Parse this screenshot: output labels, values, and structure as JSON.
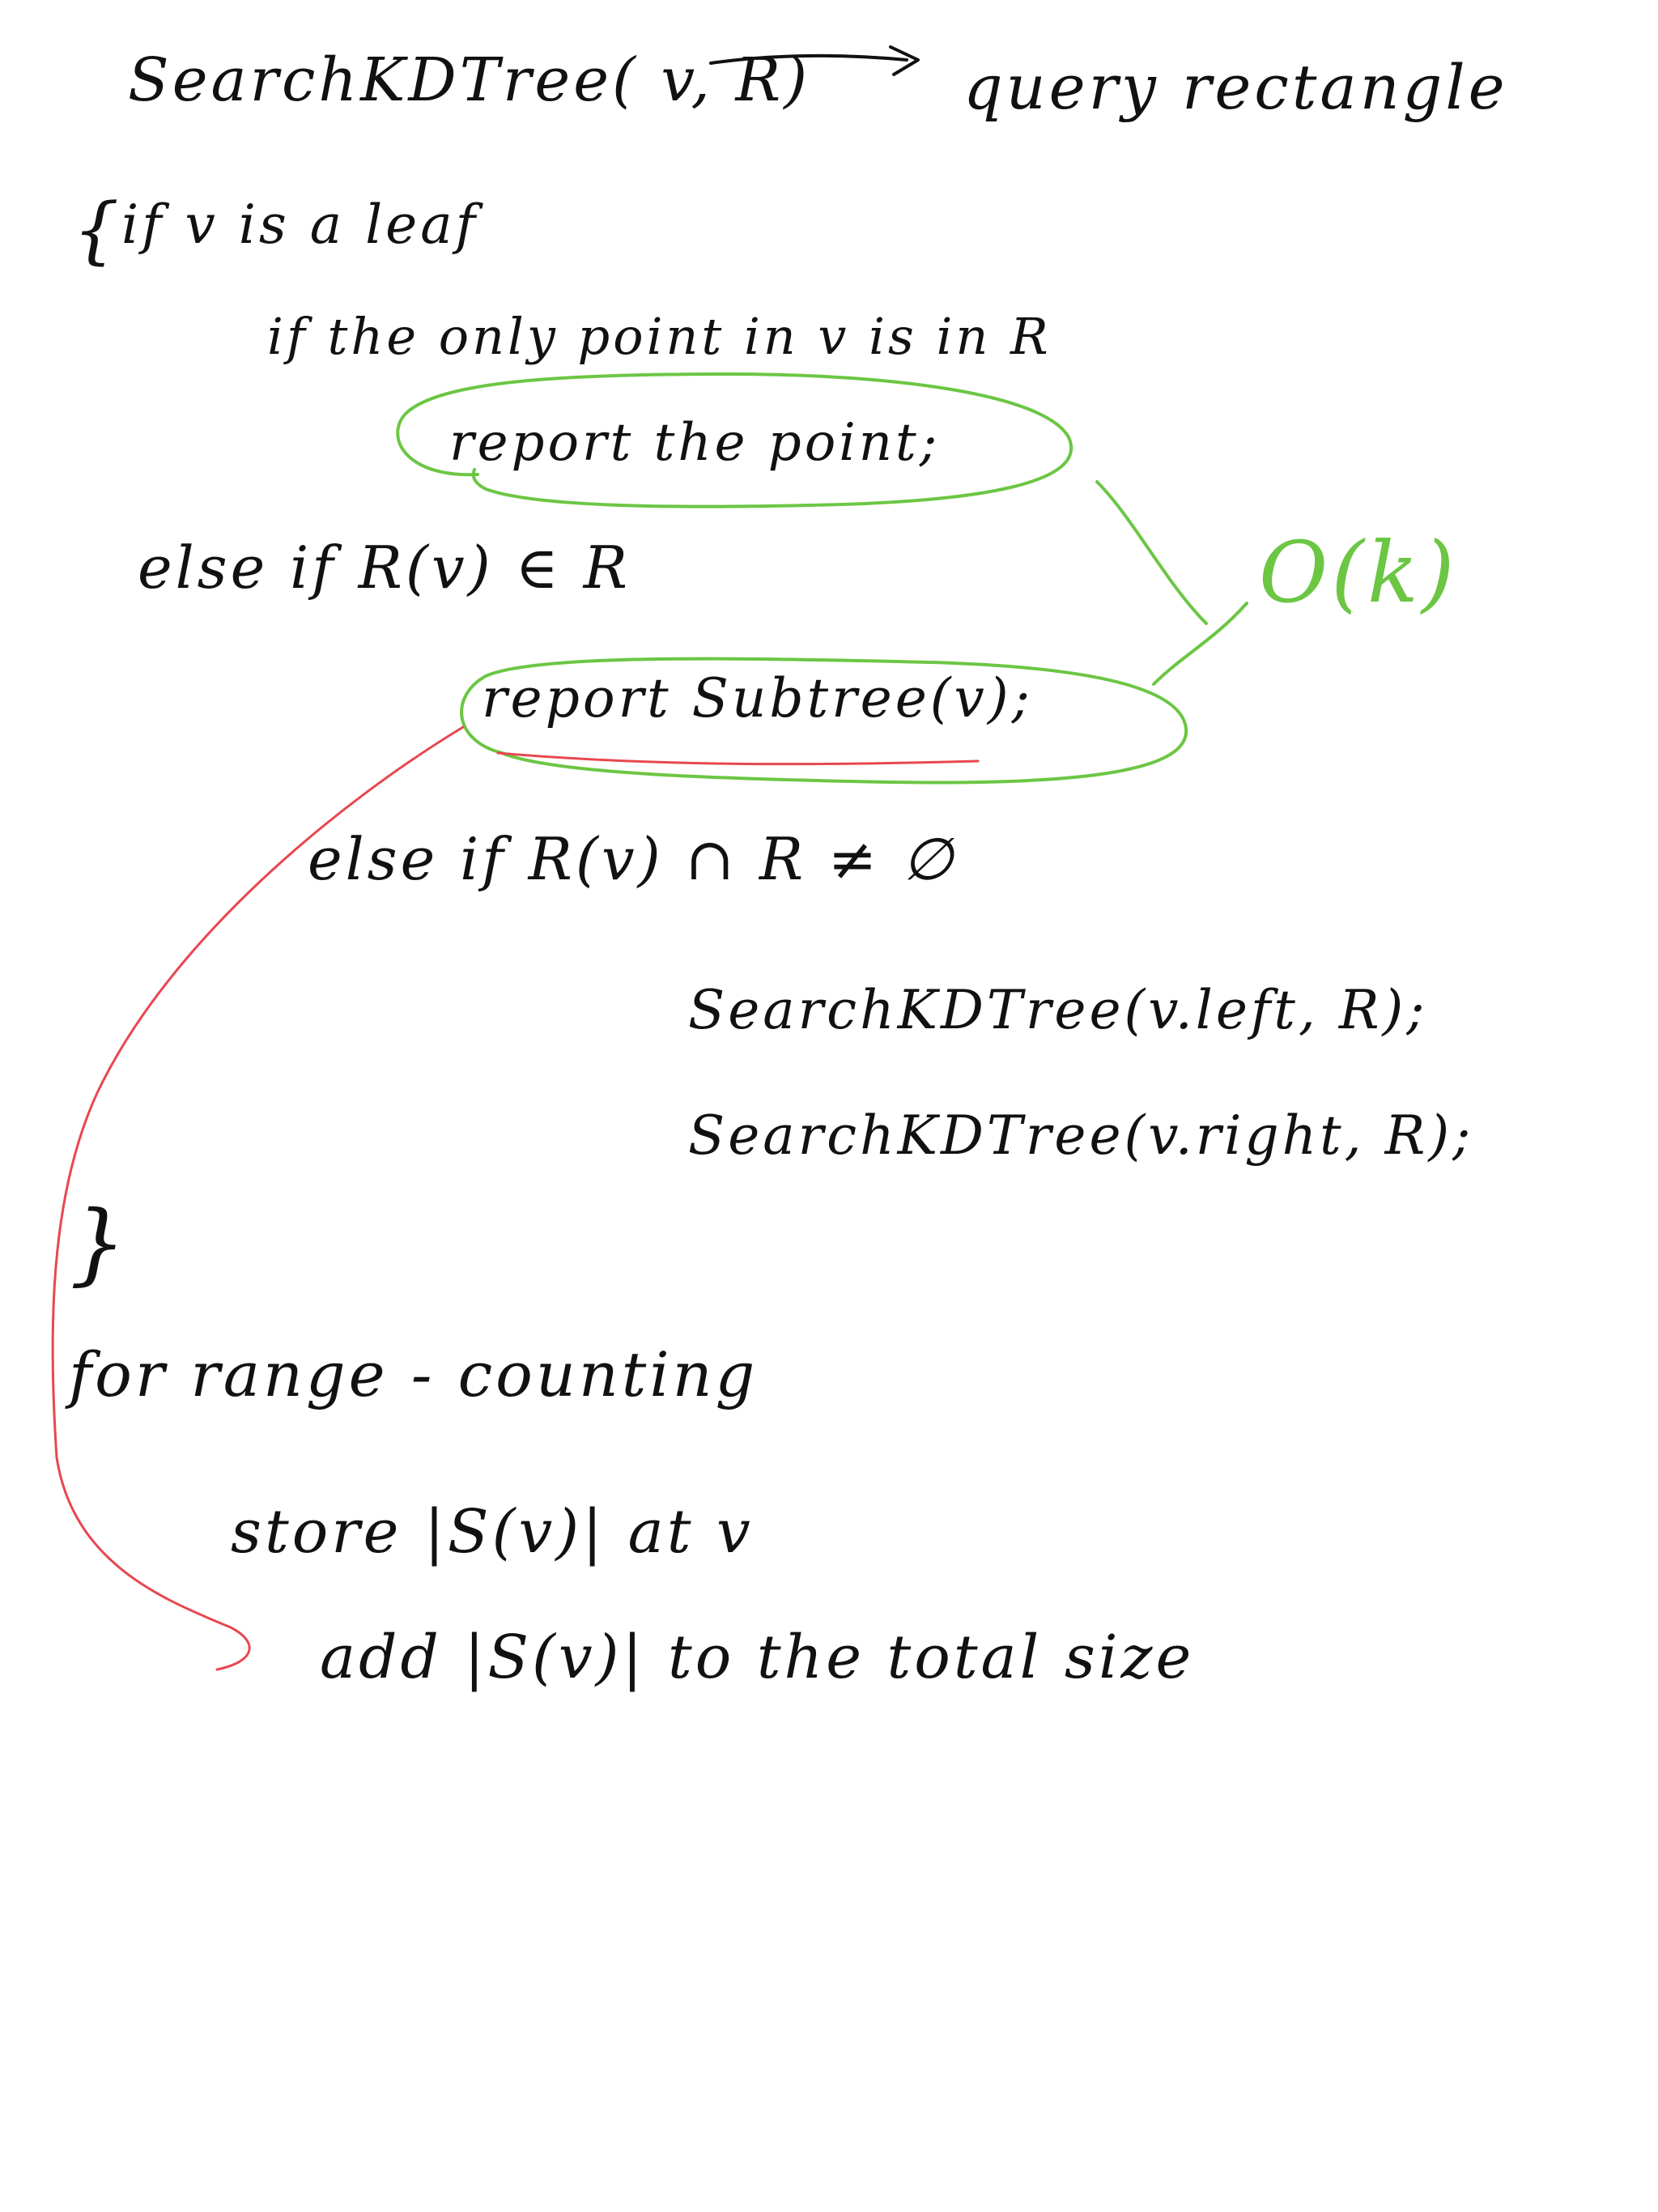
{
  "note": {
    "line_signature": "SearchKDTree( v, R)",
    "line_arrow_label": "query rectangle",
    "line_open_brace": "{",
    "line_if_leaf": "if v is a leaf",
    "line_if_point": "if the only point in v is in R",
    "line_report_point": "report the point;",
    "line_else_contained": "else if R(v) ∈ R",
    "line_report_subtree": "report Subtree(v);",
    "line_else_intersect": "else if R(v) ∩ R ≠ ∅",
    "line_search_left": "SearchKDTree(v.left, R);",
    "line_search_right": "SearchKDTree(v.right, R);",
    "line_close_brace": "}",
    "line_range_counting": "for range - counting",
    "line_store": "store |S(v)| at v",
    "line_add": "add |S(v)| to the total size",
    "complexity_label": "O(k)"
  },
  "colors": {
    "ink": "#111111",
    "green_annotation": "#6cc644",
    "red_annotation": "#e8474f"
  }
}
